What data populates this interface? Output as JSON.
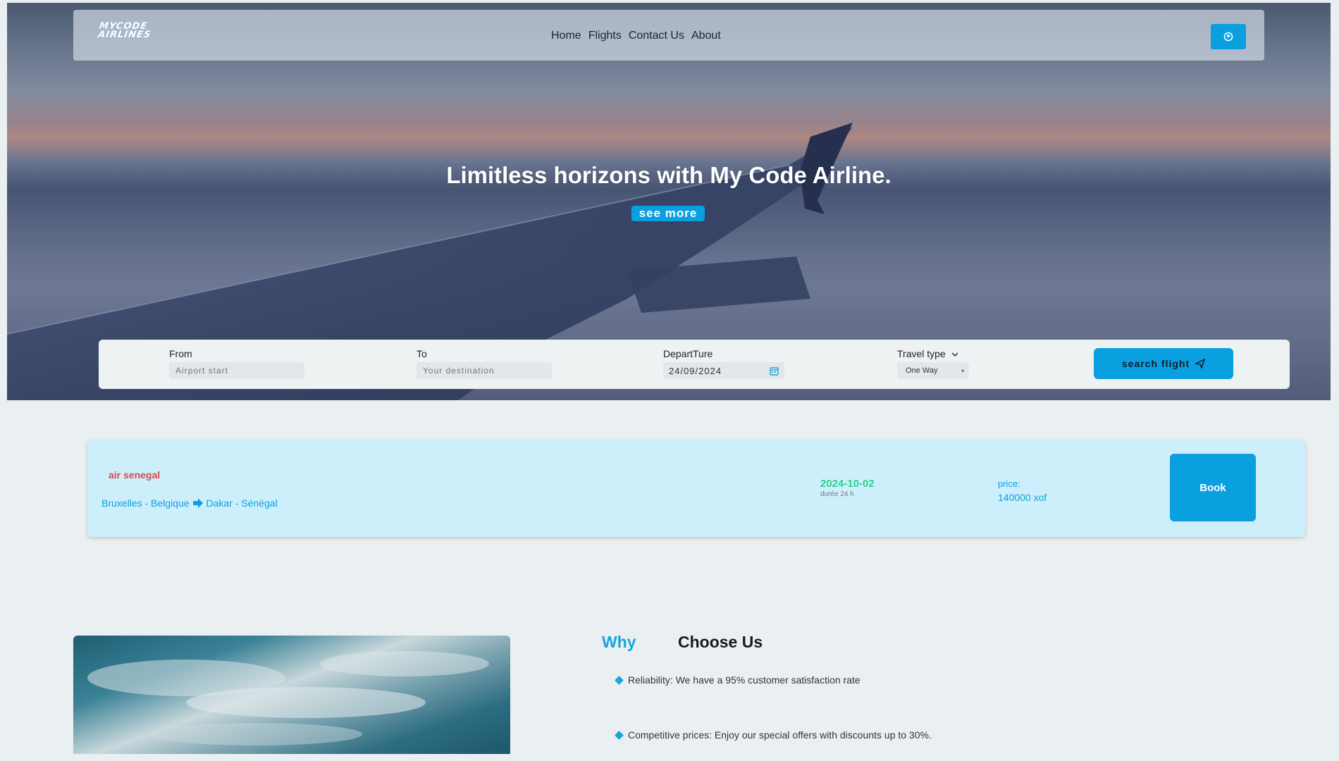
{
  "app": {
    "logo_text": "MYCODE AIRLINES"
  },
  "nav": {
    "links": [
      "Home",
      "Flights",
      "Contact Us",
      "About"
    ]
  },
  "hero": {
    "title": "Limitless horizons with My Code Airline.",
    "cta_label": "see more"
  },
  "search": {
    "from_label": "From",
    "from_placeholder": "Airport start",
    "to_label": "To",
    "to_placeholder": "Your destination",
    "departure_label": "DepartTure",
    "departure_value": "24/09/2024",
    "travel_type_label": "Travel type",
    "travel_type_value": "One Way",
    "button_label": "search flight"
  },
  "flight": {
    "airline": "air senegal",
    "origin": "Bruxelles - Belgique",
    "destination": "Dakar - Sénégal",
    "date": "2024-10-02",
    "duration": "durée 24 h",
    "price_label": "price:",
    "price_value": "140000 xof",
    "book_label": "Book"
  },
  "why": {
    "title_accent": "Why",
    "title_rest": "Choose Us",
    "items": [
      "Reliability: We have a 95% customer satisfaction rate",
      "Competitive prices: Enjoy our special offers with discounts up to 30%."
    ]
  },
  "colors": {
    "accent": "#0aa0e0",
    "airline_red": "#e04747",
    "date_green": "#2ed18b",
    "card_bg": "#cdeffc"
  },
  "icons": {
    "nav_button": "user-icon",
    "calendar": "calendar-icon",
    "dropdown": "chevron-down-icon",
    "search_button": "plane-icon",
    "route_arrow": "arrow-right-icon",
    "bullet": "diamond-icon"
  }
}
